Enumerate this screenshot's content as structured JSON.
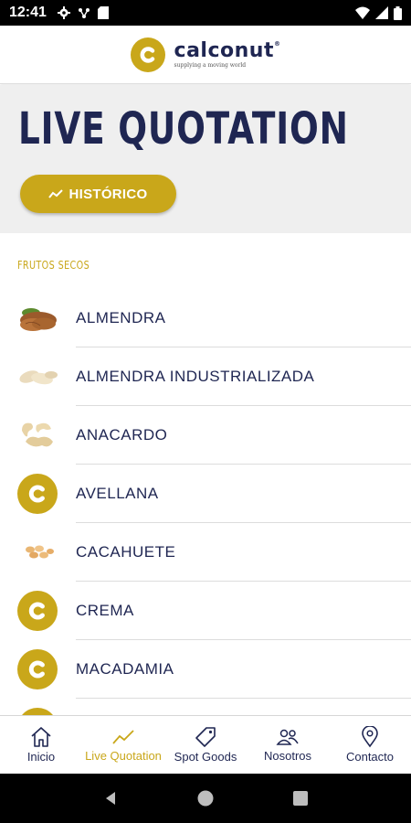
{
  "status_bar": {
    "time": "12:41"
  },
  "header": {
    "brand_name": "calconut",
    "brand_mark": "®",
    "tagline": "supplying a moving world"
  },
  "hero": {
    "title": "LIVE QUOTATION",
    "historico_label": "HISTÓRICO"
  },
  "list": {
    "section_label": "FRUTOS SECOS",
    "items": [
      {
        "label": "ALMENDRA",
        "icon": "almond-icon"
      },
      {
        "label": "ALMENDRA INDUSTRIALIZADA",
        "icon": "almond-kernel-icon"
      },
      {
        "label": "ANACARDO",
        "icon": "cashew-icon"
      },
      {
        "label": "AVELLANA",
        "icon": "calconut-logo-icon"
      },
      {
        "label": "CACAHUETE",
        "icon": "peanut-icon"
      },
      {
        "label": "CREMA",
        "icon": "calconut-logo-icon"
      },
      {
        "label": "MACADAMIA",
        "icon": "calconut-logo-icon"
      }
    ]
  },
  "bottom_nav": {
    "items": [
      {
        "label": "Inicio",
        "icon": "home-icon"
      },
      {
        "label": "Live Quotation",
        "icon": "trend-icon",
        "active": true
      },
      {
        "label": "Spot Goods",
        "icon": "tag-icon"
      },
      {
        "label": "Nosotros",
        "icon": "people-icon"
      },
      {
        "label": "Contacto",
        "icon": "location-pin-icon"
      }
    ]
  },
  "colors": {
    "gold": "#c9a71a",
    "navy": "#1f2652",
    "hero_bg": "#efefef"
  }
}
